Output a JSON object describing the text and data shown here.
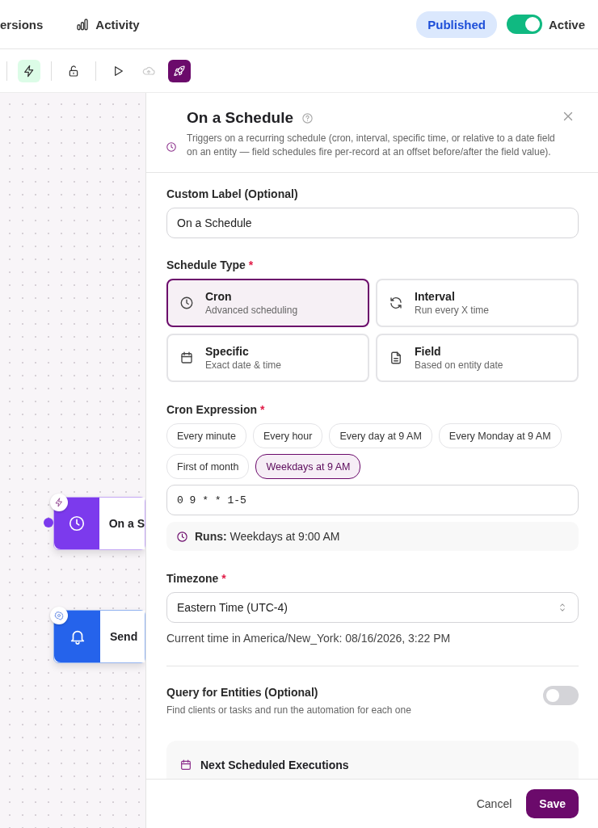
{
  "header": {
    "tabs": [
      {
        "kind": "versions",
        "label": "ersions"
      },
      {
        "kind": "activity",
        "label": "Activity"
      }
    ],
    "status_badge": "Published",
    "active_toggle": {
      "label": "Active",
      "on": true
    }
  },
  "toolbar": [
    {
      "kind": "trigger",
      "selected": true,
      "disabled": false
    },
    {
      "kind": "lock",
      "selected": false,
      "disabled": false
    },
    {
      "kind": "run",
      "selected": false,
      "disabled": false
    },
    {
      "kind": "upload",
      "selected": false,
      "disabled": true
    },
    {
      "kind": "deploy",
      "selected": false,
      "disabled": false
    }
  ],
  "canvas": {
    "nodes": [
      {
        "kind": "trigger",
        "label": "On a S"
      },
      {
        "kind": "action",
        "label": "Send"
      }
    ]
  },
  "panel": {
    "title": "On a Schedule",
    "description": "Triggers on a recurring schedule (cron, interval, specific time, or relative to a date field on an entity — field schedules fire per-record at an offset before/after the field value).",
    "custom_label": {
      "label": "Custom Label (Optional)",
      "value": "On a Schedule"
    },
    "schedule_type": {
      "label": "Schedule Type",
      "required_mark": "*",
      "options": [
        {
          "kind": "cron",
          "title": "Cron",
          "subtitle": "Advanced scheduling",
          "selected": true
        },
        {
          "kind": "interval",
          "title": "Interval",
          "subtitle": "Run every X time",
          "selected": false
        },
        {
          "kind": "specific",
          "title": "Specific",
          "subtitle": "Exact date & time",
          "selected": false
        },
        {
          "kind": "field",
          "title": "Field",
          "subtitle": "Based on entity date",
          "selected": false
        }
      ]
    },
    "cron": {
      "label": "Cron Expression",
      "required_mark": "*",
      "presets": [
        {
          "label": "Every minute",
          "selected": false
        },
        {
          "label": "Every hour",
          "selected": false
        },
        {
          "label": "Every day at 9 AM",
          "selected": false
        },
        {
          "label": "Every Monday at 9 AM",
          "selected": false
        },
        {
          "label": "First of month",
          "selected": false
        },
        {
          "label": "Weekdays at 9 AM",
          "selected": true
        }
      ],
      "value": "0 9 * * 1-5",
      "runs": "**Runs:** Weekdays at 9:00 AM"
    },
    "timezone": {
      "label": "Timezone",
      "required_mark": "*",
      "value": "Eastern Time (UTC-4)",
      "note": "Current time in America/New_York: 08/16/2026, 3:22 PM"
    },
    "query": {
      "title": "Query for Entities (Optional)",
      "description": "Find clients or tasks and run the automation for each one",
      "on": false
    },
    "next_executions": {
      "title": "Next Scheduled Executions"
    },
    "footer": {
      "cancel": "Cancel",
      "save": "Save"
    }
  }
}
